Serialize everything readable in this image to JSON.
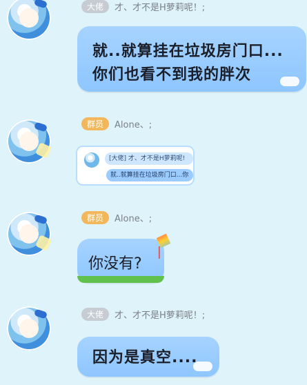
{
  "messages": [
    {
      "sender_badge": "大佬",
      "sender_name": "才、才不是H萝莉呢！;",
      "text_lines": [
        "就..就算挂在垃圾房门口...",
        "你们也看不到我的胖次"
      ]
    },
    {
      "sender_badge": "群员",
      "sender_name": "Alone、;",
      "quote": {
        "line1": "[大佬] 才、才不是H萝莉呢!",
        "line2": "就..就算挂在垃圾房门口...你"
      }
    },
    {
      "sender_badge": "群员",
      "sender_name": "Alone、;",
      "text": "你没有?"
    },
    {
      "sender_badge": "大佬",
      "sender_name": "才、才不是H萝莉呢！;",
      "text": "因为是真空...."
    }
  ]
}
